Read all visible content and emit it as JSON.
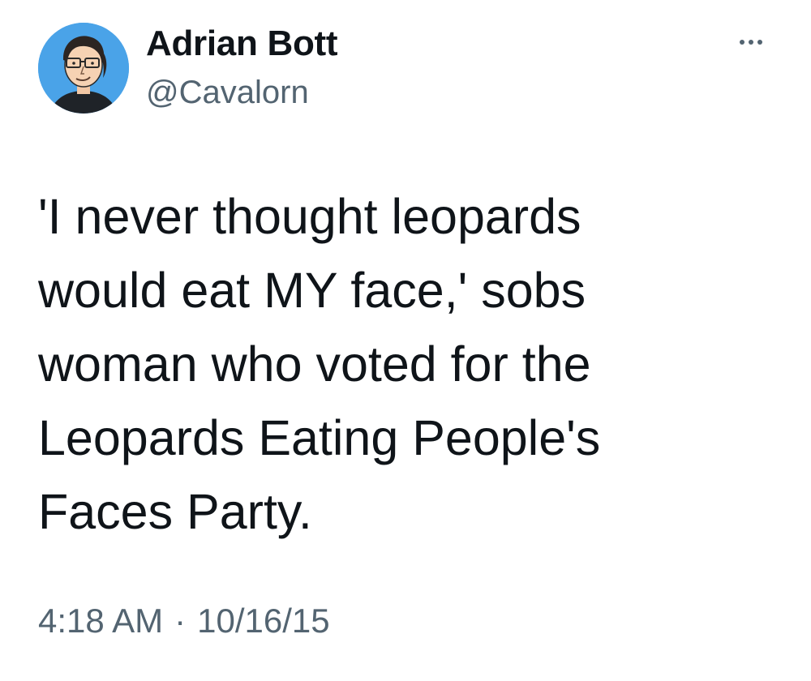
{
  "tweet": {
    "author": {
      "display_name": "Adrian Bott",
      "handle": "@Cavalorn",
      "avatar": "cartoon-portrait-avatar"
    },
    "more_icon": "more-horizontal-icon",
    "text": "'I never thought leopards\nwould eat MY face,' sobs\nwoman who voted for the\nLeopards Eating People's\nFaces Party.",
    "time": "4:18 AM",
    "separator": "·",
    "date": "10/16/15"
  },
  "colors": {
    "text_primary": "#0f1419",
    "text_secondary": "#536471",
    "avatar_background": "#4aa3e8"
  }
}
